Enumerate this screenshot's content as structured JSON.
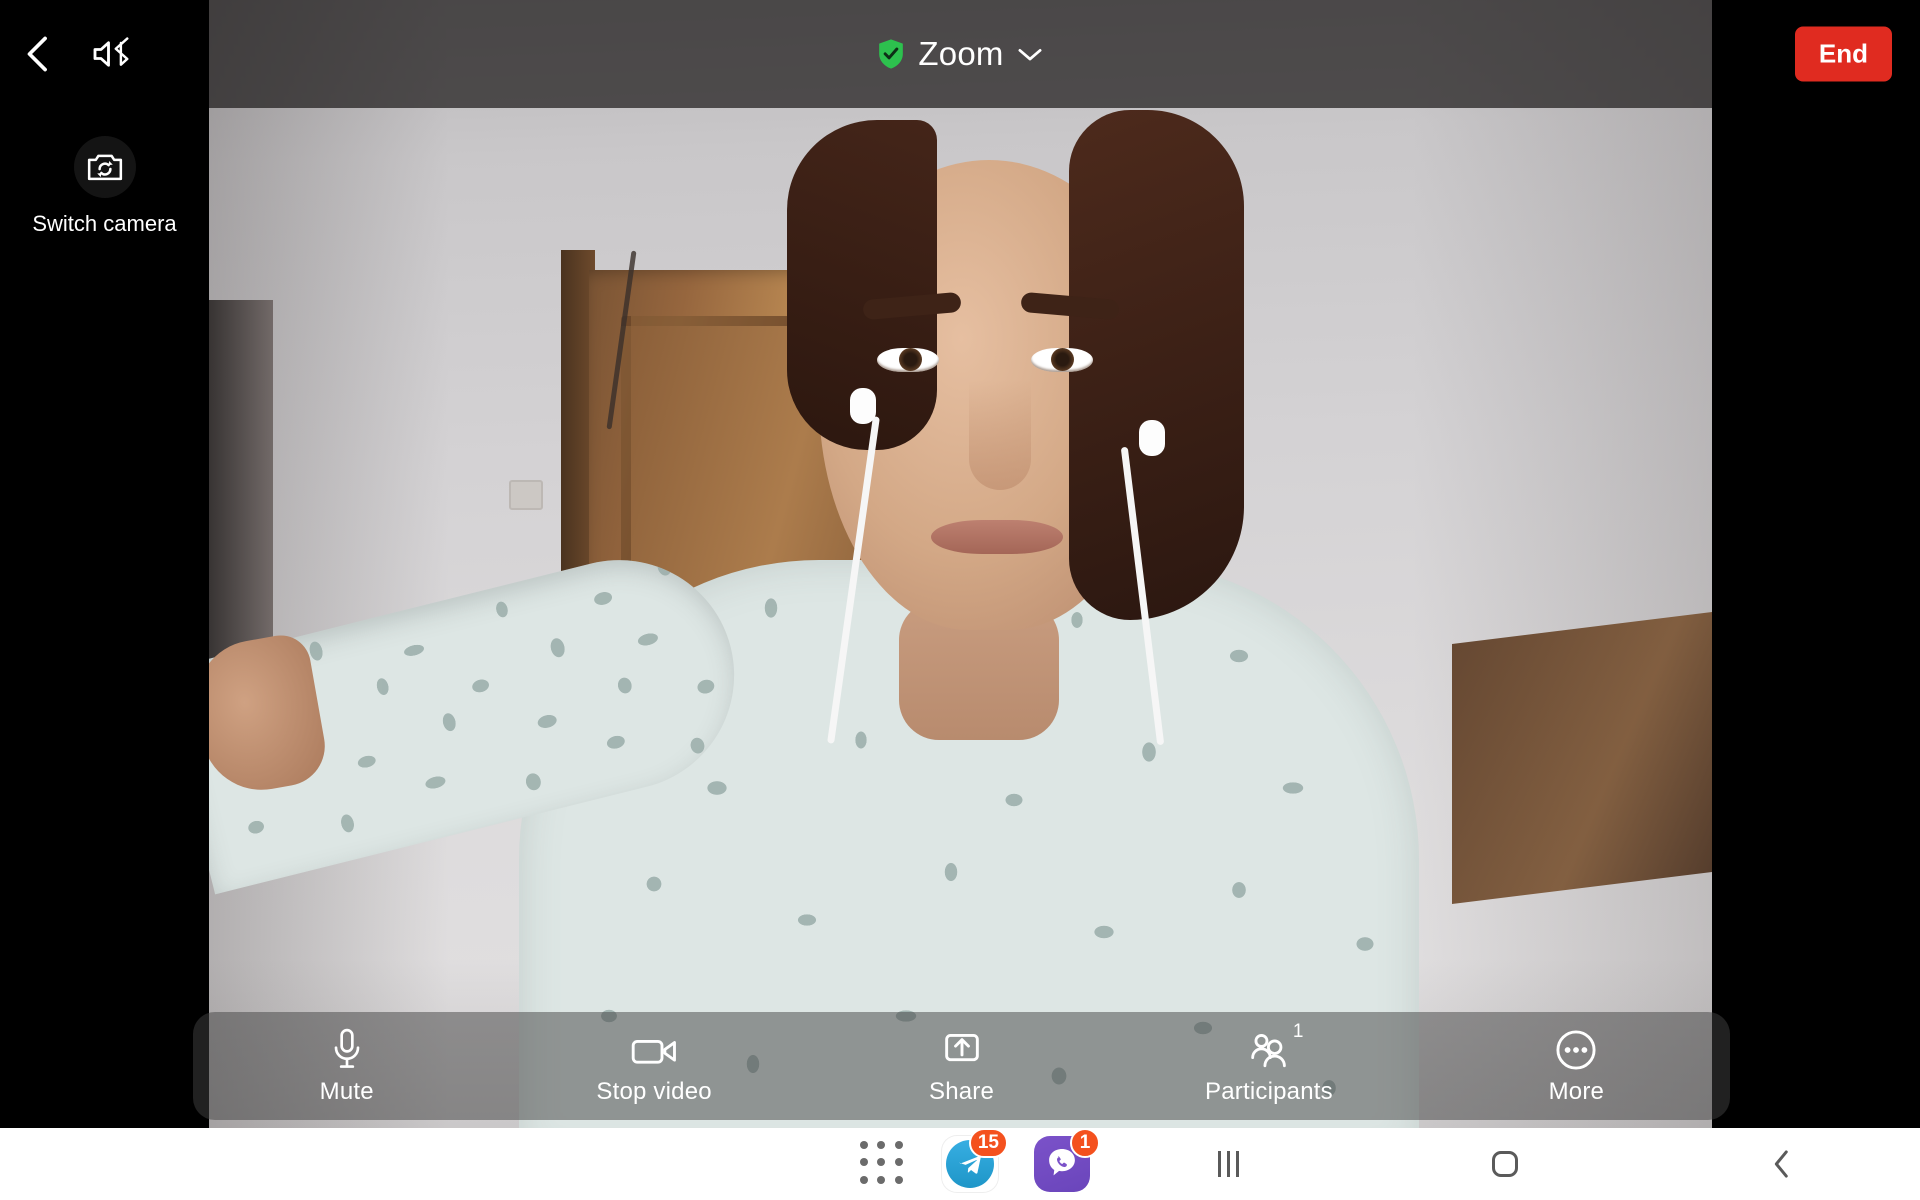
{
  "app": {
    "name": "Zoom",
    "platform": "android"
  },
  "top_bar": {
    "back_icon": "back-chevron-icon",
    "speaker_icon": "speaker-bluetooth-icon",
    "shield_icon": "shield-check-icon",
    "title": "Zoom",
    "title_chevron_icon": "chevron-down-icon",
    "end_label": "End",
    "end_color": "#e02b20",
    "shield_color": "#2dc14e"
  },
  "left_rail": {
    "switch_camera": {
      "icon": "switch-camera-icon",
      "label": "Switch camera"
    }
  },
  "controls": [
    {
      "id": "mute",
      "icon": "microphone-icon",
      "label": "Mute",
      "badge": null
    },
    {
      "id": "stop-video",
      "icon": "video-camera-icon",
      "label": "Stop video",
      "badge": null
    },
    {
      "id": "share",
      "icon": "share-upload-icon",
      "label": "Share",
      "badge": null
    },
    {
      "id": "participants",
      "icon": "participants-icon",
      "label": "Participants",
      "badge": "1"
    },
    {
      "id": "more",
      "icon": "more-dots-icon",
      "label": "More",
      "badge": null
    }
  ],
  "nav_bar": {
    "apps_grid_icon": "apps-grid-icon",
    "apps": [
      {
        "name": "Telegram",
        "icon": "telegram-icon",
        "badge": "15",
        "badge_color": "#f4511e",
        "brand_color": "#37aee2"
      },
      {
        "name": "Viber",
        "icon": "viber-icon",
        "badge": "1",
        "badge_color": "#f4511e",
        "brand_color": "#7b52c9"
      }
    ],
    "buttons": [
      {
        "id": "recents",
        "icon": "recents-icon"
      },
      {
        "id": "home",
        "icon": "home-icon"
      },
      {
        "id": "back",
        "icon": "back-chevron-icon"
      }
    ]
  },
  "video": {
    "self_view_label": "",
    "description": "self-view camera feed"
  }
}
